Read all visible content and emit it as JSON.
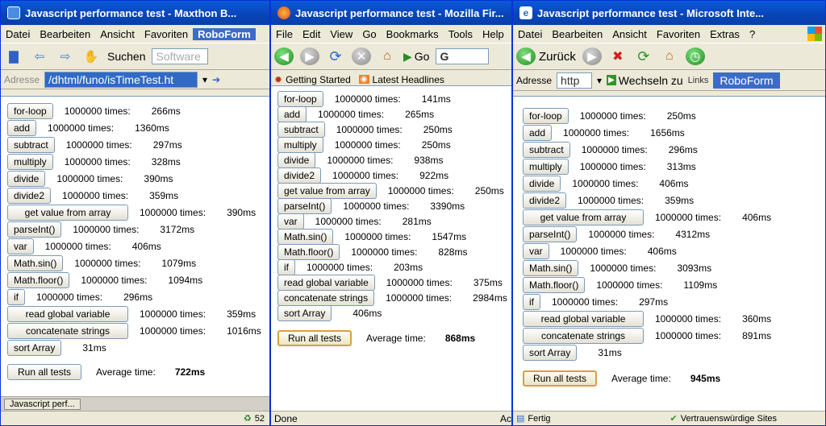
{
  "windows": {
    "maxthon": {
      "title": "Javascript performance test - Maxthon B...",
      "menu": [
        "Datei",
        "Bearbeiten",
        "Ansicht",
        "Favoriten",
        "RoboForm"
      ],
      "search_label": "Suchen",
      "search_placeholder": "Software",
      "address_label": "Adresse",
      "address_value": "/dhtml/funo/isTimeTest.ht",
      "taskbar_item": "Javascript perf...",
      "status_count": "52",
      "results": [
        {
          "label": "for-loop",
          "times": "1000000 times:",
          "ms": "266ms"
        },
        {
          "label": "add",
          "times": "1000000 times:",
          "ms": "1360ms"
        },
        {
          "label": "subtract",
          "times": "1000000 times:",
          "ms": "297ms"
        },
        {
          "label": "multiply",
          "times": "1000000 times:",
          "ms": "328ms"
        },
        {
          "label": "divide",
          "times": "1000000 times:",
          "ms": "390ms"
        },
        {
          "label": "divide2",
          "times": "1000000 times:",
          "ms": "359ms"
        },
        {
          "label": "get value from array",
          "times": "1000000 times:",
          "ms": "390ms"
        },
        {
          "label": "parseInt()",
          "times": "1000000 times:",
          "ms": "3172ms"
        },
        {
          "label": "var",
          "times": "1000000 times:",
          "ms": "406ms"
        },
        {
          "label": "Math.sin()",
          "times": "1000000 times:",
          "ms": "1079ms"
        },
        {
          "label": "Math.floor()",
          "times": "1000000 times:",
          "ms": "1094ms"
        },
        {
          "label": "if",
          "times": "1000000 times:",
          "ms": "296ms"
        },
        {
          "label": "read global variable",
          "times": "1000000 times:",
          "ms": "359ms"
        },
        {
          "label": "concatenate strings",
          "times": "1000000 times:",
          "ms": "1016ms"
        },
        {
          "label": "sort Array",
          "times": "",
          "ms": "31ms"
        }
      ],
      "run_label": "Run all tests",
      "avg_label": "Average time:",
      "avg_value": "722ms"
    },
    "firefox": {
      "title": "Javascript performance test - Mozilla Fir...",
      "menu": [
        "File",
        "Edit",
        "View",
        "Go",
        "Bookmarks",
        "Tools",
        "Help"
      ],
      "go_label": "Go",
      "search_value": "G",
      "bookmarks": [
        "Getting Started",
        "Latest Headlines"
      ],
      "status": "Done",
      "status_right": "Ac",
      "results": [
        {
          "label": "for-loop",
          "times": "1000000 times:",
          "ms": "141ms"
        },
        {
          "label": "add",
          "times": "1000000 times:",
          "ms": "265ms"
        },
        {
          "label": "subtract",
          "times": "1000000 times:",
          "ms": "250ms"
        },
        {
          "label": "multiply",
          "times": "1000000 times:",
          "ms": "250ms"
        },
        {
          "label": "divide",
          "times": "1000000 times:",
          "ms": "938ms"
        },
        {
          "label": "divide2",
          "times": "1000000 times:",
          "ms": "922ms"
        },
        {
          "label": "get value from array",
          "times": "1000000 times:",
          "ms": "250ms"
        },
        {
          "label": "parseInt()",
          "times": "1000000 times:",
          "ms": "3390ms"
        },
        {
          "label": "var",
          "times": "1000000 times:",
          "ms": "281ms"
        },
        {
          "label": "Math.sin()",
          "times": "1000000 times:",
          "ms": "1547ms"
        },
        {
          "label": "Math.floor()",
          "times": "1000000 times:",
          "ms": "828ms"
        },
        {
          "label": "if",
          "times": "1000000 times:",
          "ms": "203ms"
        },
        {
          "label": "read global variable",
          "times": "1000000 times:",
          "ms": "375ms"
        },
        {
          "label": "concatenate strings",
          "times": "1000000 times:",
          "ms": "2984ms"
        },
        {
          "label": "sort Array",
          "times": "",
          "ms": "406ms"
        }
      ],
      "run_label": "Run all tests",
      "avg_label": "Average time:",
      "avg_value": "868ms"
    },
    "ie": {
      "title": "Javascript performance test - Microsoft Inte...",
      "menu": [
        "Datei",
        "Bearbeiten",
        "Ansicht",
        "Favoriten",
        "Extras",
        "?"
      ],
      "back_label": "Zurück",
      "address_label": "Adresse",
      "address_value": "http",
      "go_label": "Wechseln zu",
      "links_label": "Links",
      "roboform_label": "RoboForm",
      "status": "Fertig",
      "status_zone": "Vertrauenswürdige Sites",
      "results": [
        {
          "label": "for-loop",
          "times": "1000000 times:",
          "ms": "250ms"
        },
        {
          "label": "add",
          "times": "1000000 times:",
          "ms": "1656ms"
        },
        {
          "label": "subtract",
          "times": "1000000 times:",
          "ms": "296ms"
        },
        {
          "label": "multiply",
          "times": "1000000 times:",
          "ms": "313ms"
        },
        {
          "label": "divide",
          "times": "1000000 times:",
          "ms": "406ms"
        },
        {
          "label": "divide2",
          "times": "1000000 times:",
          "ms": "359ms"
        },
        {
          "label": "get value from array",
          "times": "1000000 times:",
          "ms": "406ms"
        },
        {
          "label": "parseInt()",
          "times": "1000000 times:",
          "ms": "4312ms"
        },
        {
          "label": "var",
          "times": "1000000 times:",
          "ms": "406ms"
        },
        {
          "label": "Math.sin()",
          "times": "1000000 times:",
          "ms": "3093ms"
        },
        {
          "label": "Math.floor()",
          "times": "1000000 times:",
          "ms": "1109ms"
        },
        {
          "label": "if",
          "times": "1000000 times:",
          "ms": "297ms"
        },
        {
          "label": "read global variable",
          "times": "1000000 times:",
          "ms": "360ms"
        },
        {
          "label": "concatenate strings",
          "times": "1000000 times:",
          "ms": "891ms"
        },
        {
          "label": "sort Array",
          "times": "",
          "ms": "31ms"
        }
      ],
      "run_label": "Run all tests",
      "avg_label": "Average time:",
      "avg_value": "945ms"
    }
  }
}
